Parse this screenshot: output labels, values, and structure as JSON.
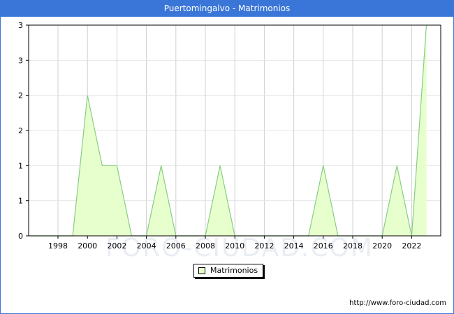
{
  "title": "Puertomingalvo - Matrimonios",
  "watermark": "FORO-CIUDAD.COM",
  "source": "http://www.foro-ciudad.com",
  "colors": {
    "accent": "#3a76d8",
    "fill": "#e6ffcc",
    "line": "#88cc88"
  },
  "chart_data": {
    "type": "area",
    "title": "Puertomingalvo - Matrimonios",
    "x": [
      1996,
      1997,
      1998,
      1999,
      2000,
      2001,
      2002,
      2003,
      2004,
      2005,
      2006,
      2007,
      2008,
      2009,
      2010,
      2011,
      2012,
      2013,
      2014,
      2015,
      2016,
      2017,
      2018,
      2019,
      2020,
      2021,
      2022,
      2023
    ],
    "series": [
      {
        "name": "Matrimonios",
        "values": [
          0,
          0,
          0,
          0,
          2,
          1,
          1,
          0,
          0,
          1,
          0,
          0,
          0,
          1,
          0,
          0,
          0,
          0,
          0,
          0,
          1,
          0,
          0,
          0,
          0,
          1,
          0,
          3
        ]
      }
    ],
    "xticks": [
      "1998",
      "2000",
      "2002",
      "2004",
      "2006",
      "2008",
      "2010",
      "2012",
      "2014",
      "2016",
      "2018",
      "2020",
      "2022"
    ],
    "yticks": [
      "0",
      "1",
      "1",
      "2",
      "2",
      "3",
      "3"
    ],
    "ylim": [
      0,
      3
    ],
    "grid": true,
    "legend_position": "bottom-center"
  }
}
